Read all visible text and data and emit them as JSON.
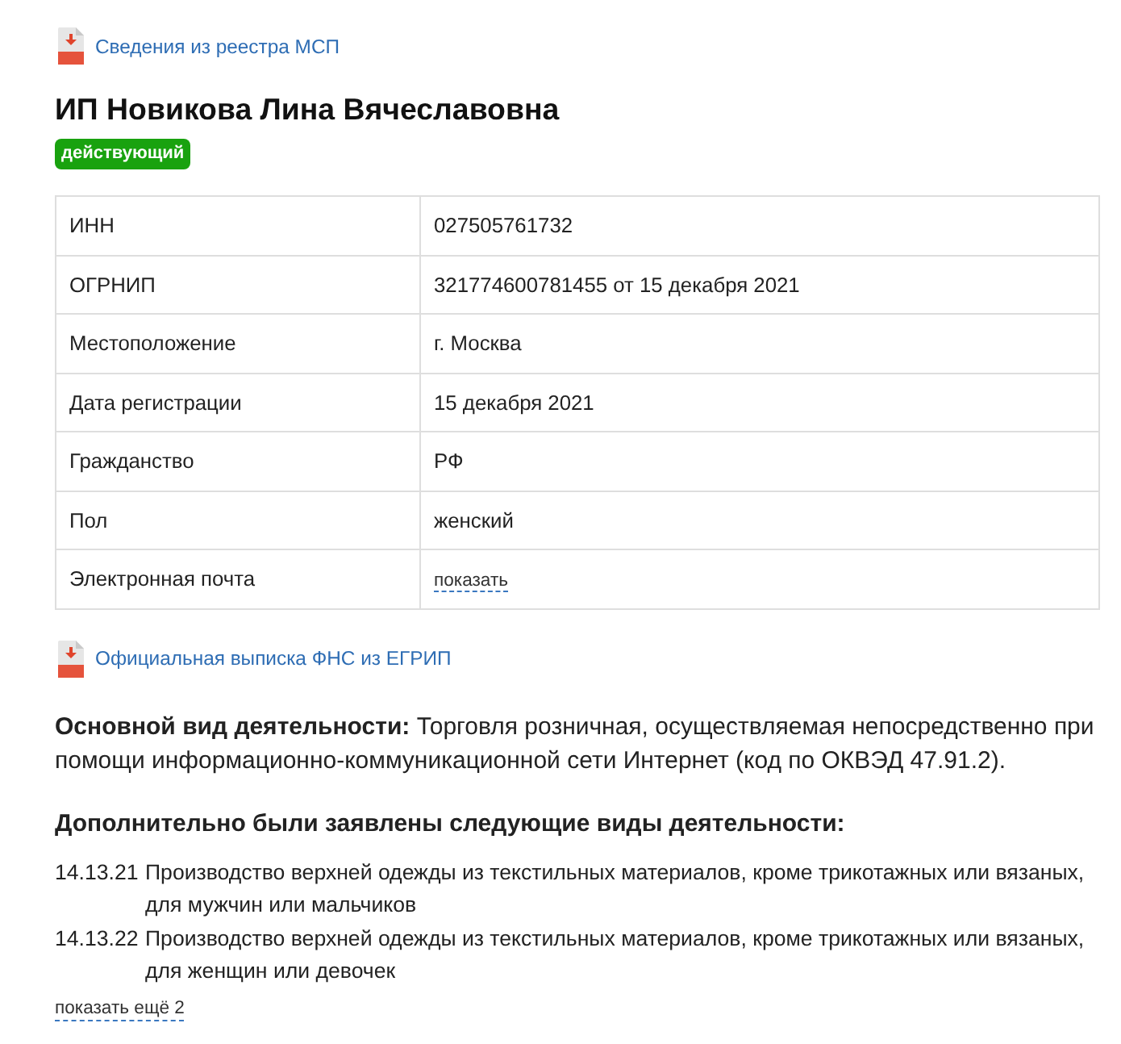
{
  "registry_link": {
    "label": "Сведения из реестра МСП"
  },
  "title": "ИП Новикова Лина Вячеславовна",
  "status_badge": {
    "label": "действующий"
  },
  "details": [
    {
      "label": "ИНН",
      "value": "027505761732",
      "kind": "text"
    },
    {
      "label": "ОГРНИП",
      "value": "321774600781455 от 15 декабря 2021",
      "kind": "text"
    },
    {
      "label": "Местоположение",
      "value": "г. Москва",
      "kind": "text"
    },
    {
      "label": "Дата регистрации",
      "value": "15 декабря 2021",
      "kind": "text"
    },
    {
      "label": "Гражданство",
      "value": "РФ",
      "kind": "text"
    },
    {
      "label": "Пол",
      "value": "женский",
      "kind": "text"
    },
    {
      "label": "Электронная почта",
      "value": "показать",
      "kind": "link"
    }
  ],
  "extract_link": {
    "label": "Официальная выписка ФНС из ЕГРИП"
  },
  "main_activity": {
    "text": "**Основной вид деятельности:** Торговля розничная, осуществляемая непосредственно при помощи информационно-коммуникационной сети Интернет (код по ОКВЭД 47.91.2)."
  },
  "additional_activities": {
    "heading": "Дополнительно были заявлены следующие виды деятельности:",
    "items": [
      {
        "code": "14.13.21",
        "name": "Производство верхней одежды из текстильных материалов, кроме трикотажных или вязаных, для мужчин или мальчиков"
      },
      {
        "code": "14.13.22",
        "name": "Производство верхней одежды из текстильных материалов, кроме трикотажных или вязаных, для женщин или девочек"
      }
    ],
    "more_link": "показать ещё 2"
  }
}
